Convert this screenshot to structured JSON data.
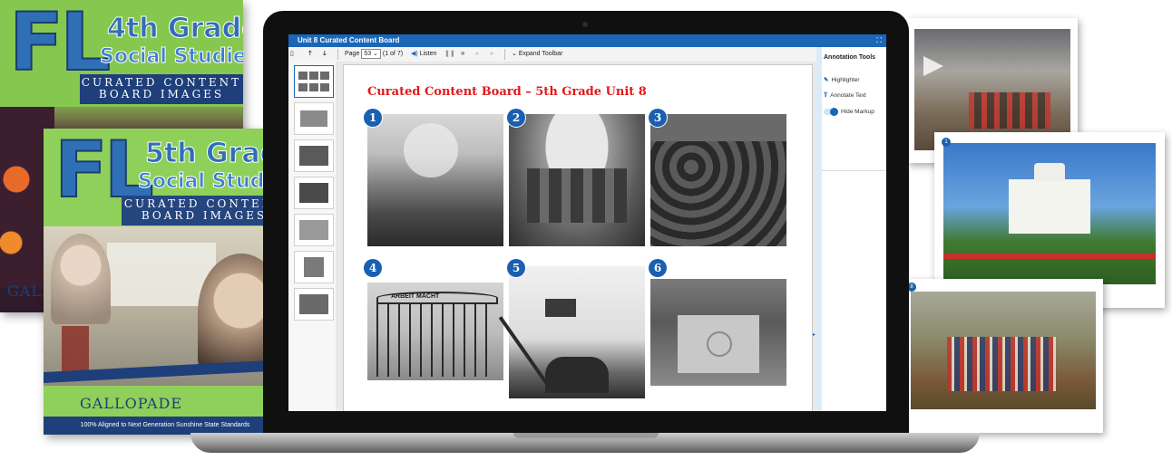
{
  "book_4th": {
    "state_abbr": "FL",
    "grade_line": "4th Grade",
    "subject_line": "Social Studies",
    "band_line1": "CURATED CONTENT",
    "band_line2": "BOARD IMAGES",
    "publisher": "GALLO"
  },
  "book_5th": {
    "state_abbr": "FL",
    "grade_line": "5th Grade",
    "subject_line": "Social Studies",
    "band_line1": "CURATED CONTENT",
    "band_line2": "BOARD IMAGES",
    "publisher": "GALLOPADE",
    "footer": "100% Aligned to Next Generation Sunshine State Standards"
  },
  "viewer": {
    "window_title": "Unit 8 Curated Content Board",
    "expand_icon": "expand-icon",
    "toolbar": {
      "page_label": "Page",
      "page_value": "53",
      "page_of": "(1 of 7)",
      "listen_label": "Listen",
      "expand_toolbar_label": "Expand Toolbar"
    },
    "thumbnail_count": 7,
    "board_title": "Curated Content Board – 5th Grade Unit 8",
    "photo_numbers": [
      "1",
      "2",
      "3",
      "4",
      "5",
      "6"
    ],
    "photo4_sign_text": "ARBEIT MACHT",
    "annotation": {
      "title": "Annotation Tools",
      "highlighter_label": "Highlighter",
      "annotate_text_label": "Annotate Text",
      "hide_markup_label": "Hide Markup"
    }
  },
  "cards": {
    "whitehouse_number": "1",
    "battle_number": "8"
  },
  "colors": {
    "accent_blue": "#1a67b8",
    "title_red": "#e0191b",
    "book_green": "#8fd05a",
    "book_navy": "#1e3f7a"
  }
}
